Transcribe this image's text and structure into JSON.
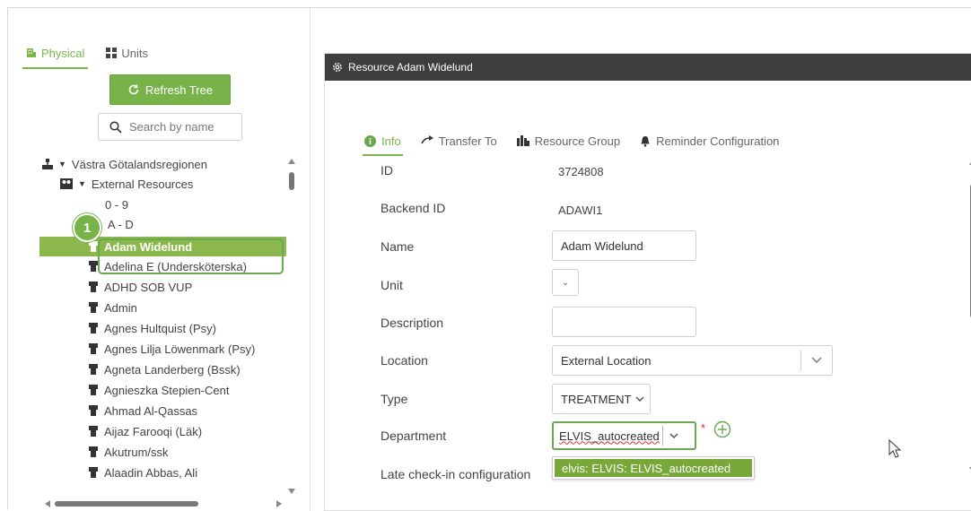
{
  "left_panel": {
    "tabs": [
      {
        "label": "Physical",
        "icon": "building-icon",
        "active": true
      },
      {
        "label": "Units",
        "icon": "grid-icon",
        "active": false
      }
    ],
    "refresh_label": "Refresh Tree",
    "search_placeholder": "Search by name",
    "tree": {
      "root": "Västra Götalandsregionen",
      "group": "External Resources",
      "ranges": [
        "0 - 9",
        "A - D"
      ],
      "items": [
        "Adam Widelund",
        "Adelina E (Undersköterska)",
        "ADHD SOB VUP",
        "Admin",
        "Agnes Hultquist (Psy)",
        "Agnes Lilja Löwenmark (Psy)",
        "Agneta Landerberg (Bssk)",
        "Agnieszka Stepien-Cent",
        "Ahmad Al-Qassas",
        "Aijaz Farooqi (Läk)",
        "Akutrum/ssk",
        "Alaadin Abbas, Ali"
      ],
      "selected": "Adam Widelund"
    },
    "step_badge": "1"
  },
  "resource": {
    "title": "Resource Adam Widelund",
    "tabs": [
      {
        "label": "Info",
        "icon": "info-icon",
        "active": true
      },
      {
        "label": "Transfer To",
        "icon": "arrow-right-icon",
        "active": false
      },
      {
        "label": "Resource Group",
        "icon": "group-icon",
        "active": false
      },
      {
        "label": "Reminder Configuration",
        "icon": "bell-icon",
        "active": false
      }
    ],
    "fields": {
      "id_label": "ID",
      "id_value": "3724808",
      "backend_label": "Backend ID",
      "backend_value": "ADAWI1",
      "name_label": "Name",
      "name_value": "Adam Widelund",
      "unit_label": "Unit",
      "description_label": "Description",
      "description_value": "",
      "location_label": "Location",
      "location_value": "External Location",
      "type_label": "Type",
      "type_value": "TREATMENT",
      "department_label": "Department",
      "department_value": "ELVIS_autocreated",
      "required_mark": "*",
      "late_label": "Late check-in configuration"
    },
    "suggestion": "elvis: ELVIS: ELVIS_autocreated"
  },
  "colors": {
    "accent": "#78b34a",
    "titlebar": "#3e3e3e",
    "selected_row": "#8ab84c",
    "required": "#d33333"
  }
}
